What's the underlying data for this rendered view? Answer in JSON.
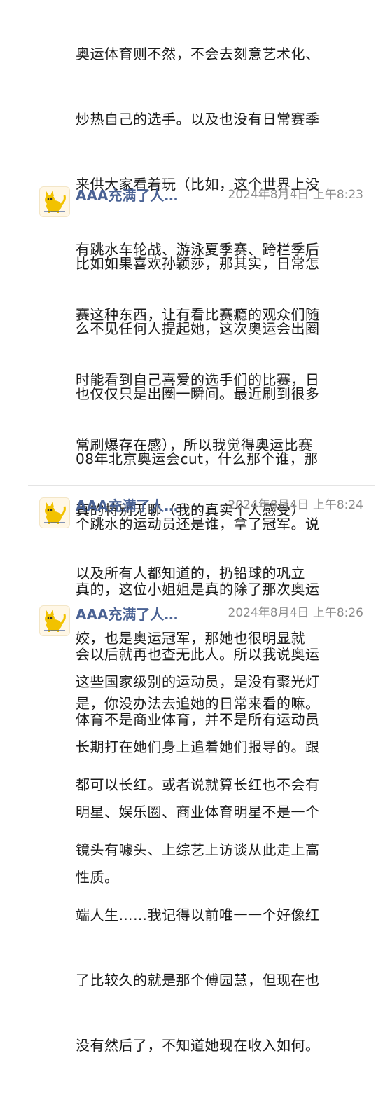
{
  "colors": {
    "sender_name": "#4a6294",
    "timestamp": "#8c8c8c",
    "body_text": "#1b1b1b",
    "side_stripe": "#ededed",
    "divider": "#e4e4e4"
  },
  "messages": [
    {
      "lines": [
        "奥运体育则不然，不会去刻意艺术化、",
        "炒热自己的选手。以及也没有日常赛季",
        "来供大家看着玩（比如，这个世界上没",
        "有跳水车轮战、游泳夏季赛、跨栏季后",
        "赛这种东西，让有看比赛瘾的观众们随",
        "时能看到自己喜爱的选手们的比赛，日",
        "常刷爆存在感），所以我觉得奥运比赛",
        "真的特别无聊（我的真实个人感受）"
      ]
    },
    {
      "sender": "AAA充满了人…",
      "avatar_icon": "cat-avatar-icon",
      "time": "2024年8月4日 上午8:23",
      "lines": [
        "比如如果喜欢孙颖莎，那其实，日常怎",
        "么不见任何人提起她，这次奥运会出圈",
        "也仅仅只是出圈一瞬间。最近刷到很多",
        "08年北京奥运会cut，什么那个谁，那",
        "个跳水的运动员还是谁，拿了冠军。说",
        "真的，这位小姐姐是真的除了那次奥运",
        "会以后就再也查无此人。所以我说奥运",
        "体育不是商业体育，并不是所有运动员",
        "都可以长红。或者说就算长红也不会有",
        "镜头有噱头、上综艺上访谈从此走上高",
        "端人生……我记得以前唯一一个好像红",
        "了比较久的就是那个傅园慧，但现在也",
        "没有然后了，不知道她现在收入如何。"
      ]
    },
    {
      "sender": "AAA充满了人…",
      "avatar_icon": "cat-avatar-icon",
      "time": "2024年8月4日 上午8:24",
      "lines": [
        "以及所有人都知道的，扔铅球的巩立",
        "姣，也是奥运冠军，那她也很明显就",
        "是，你没办法去追她的日常来看的嘛。"
      ]
    },
    {
      "sender": "AAA充满了人…",
      "avatar_icon": "cat-avatar-icon",
      "time": "2024年8月4日 上午8:26",
      "lines": [
        "这些国家级别的运动员，是没有聚光灯",
        "长期打在她们身上追着她们报导的。跟",
        "明星、娱乐圈、商业体育明星不是一个",
        "性质。"
      ]
    }
  ]
}
